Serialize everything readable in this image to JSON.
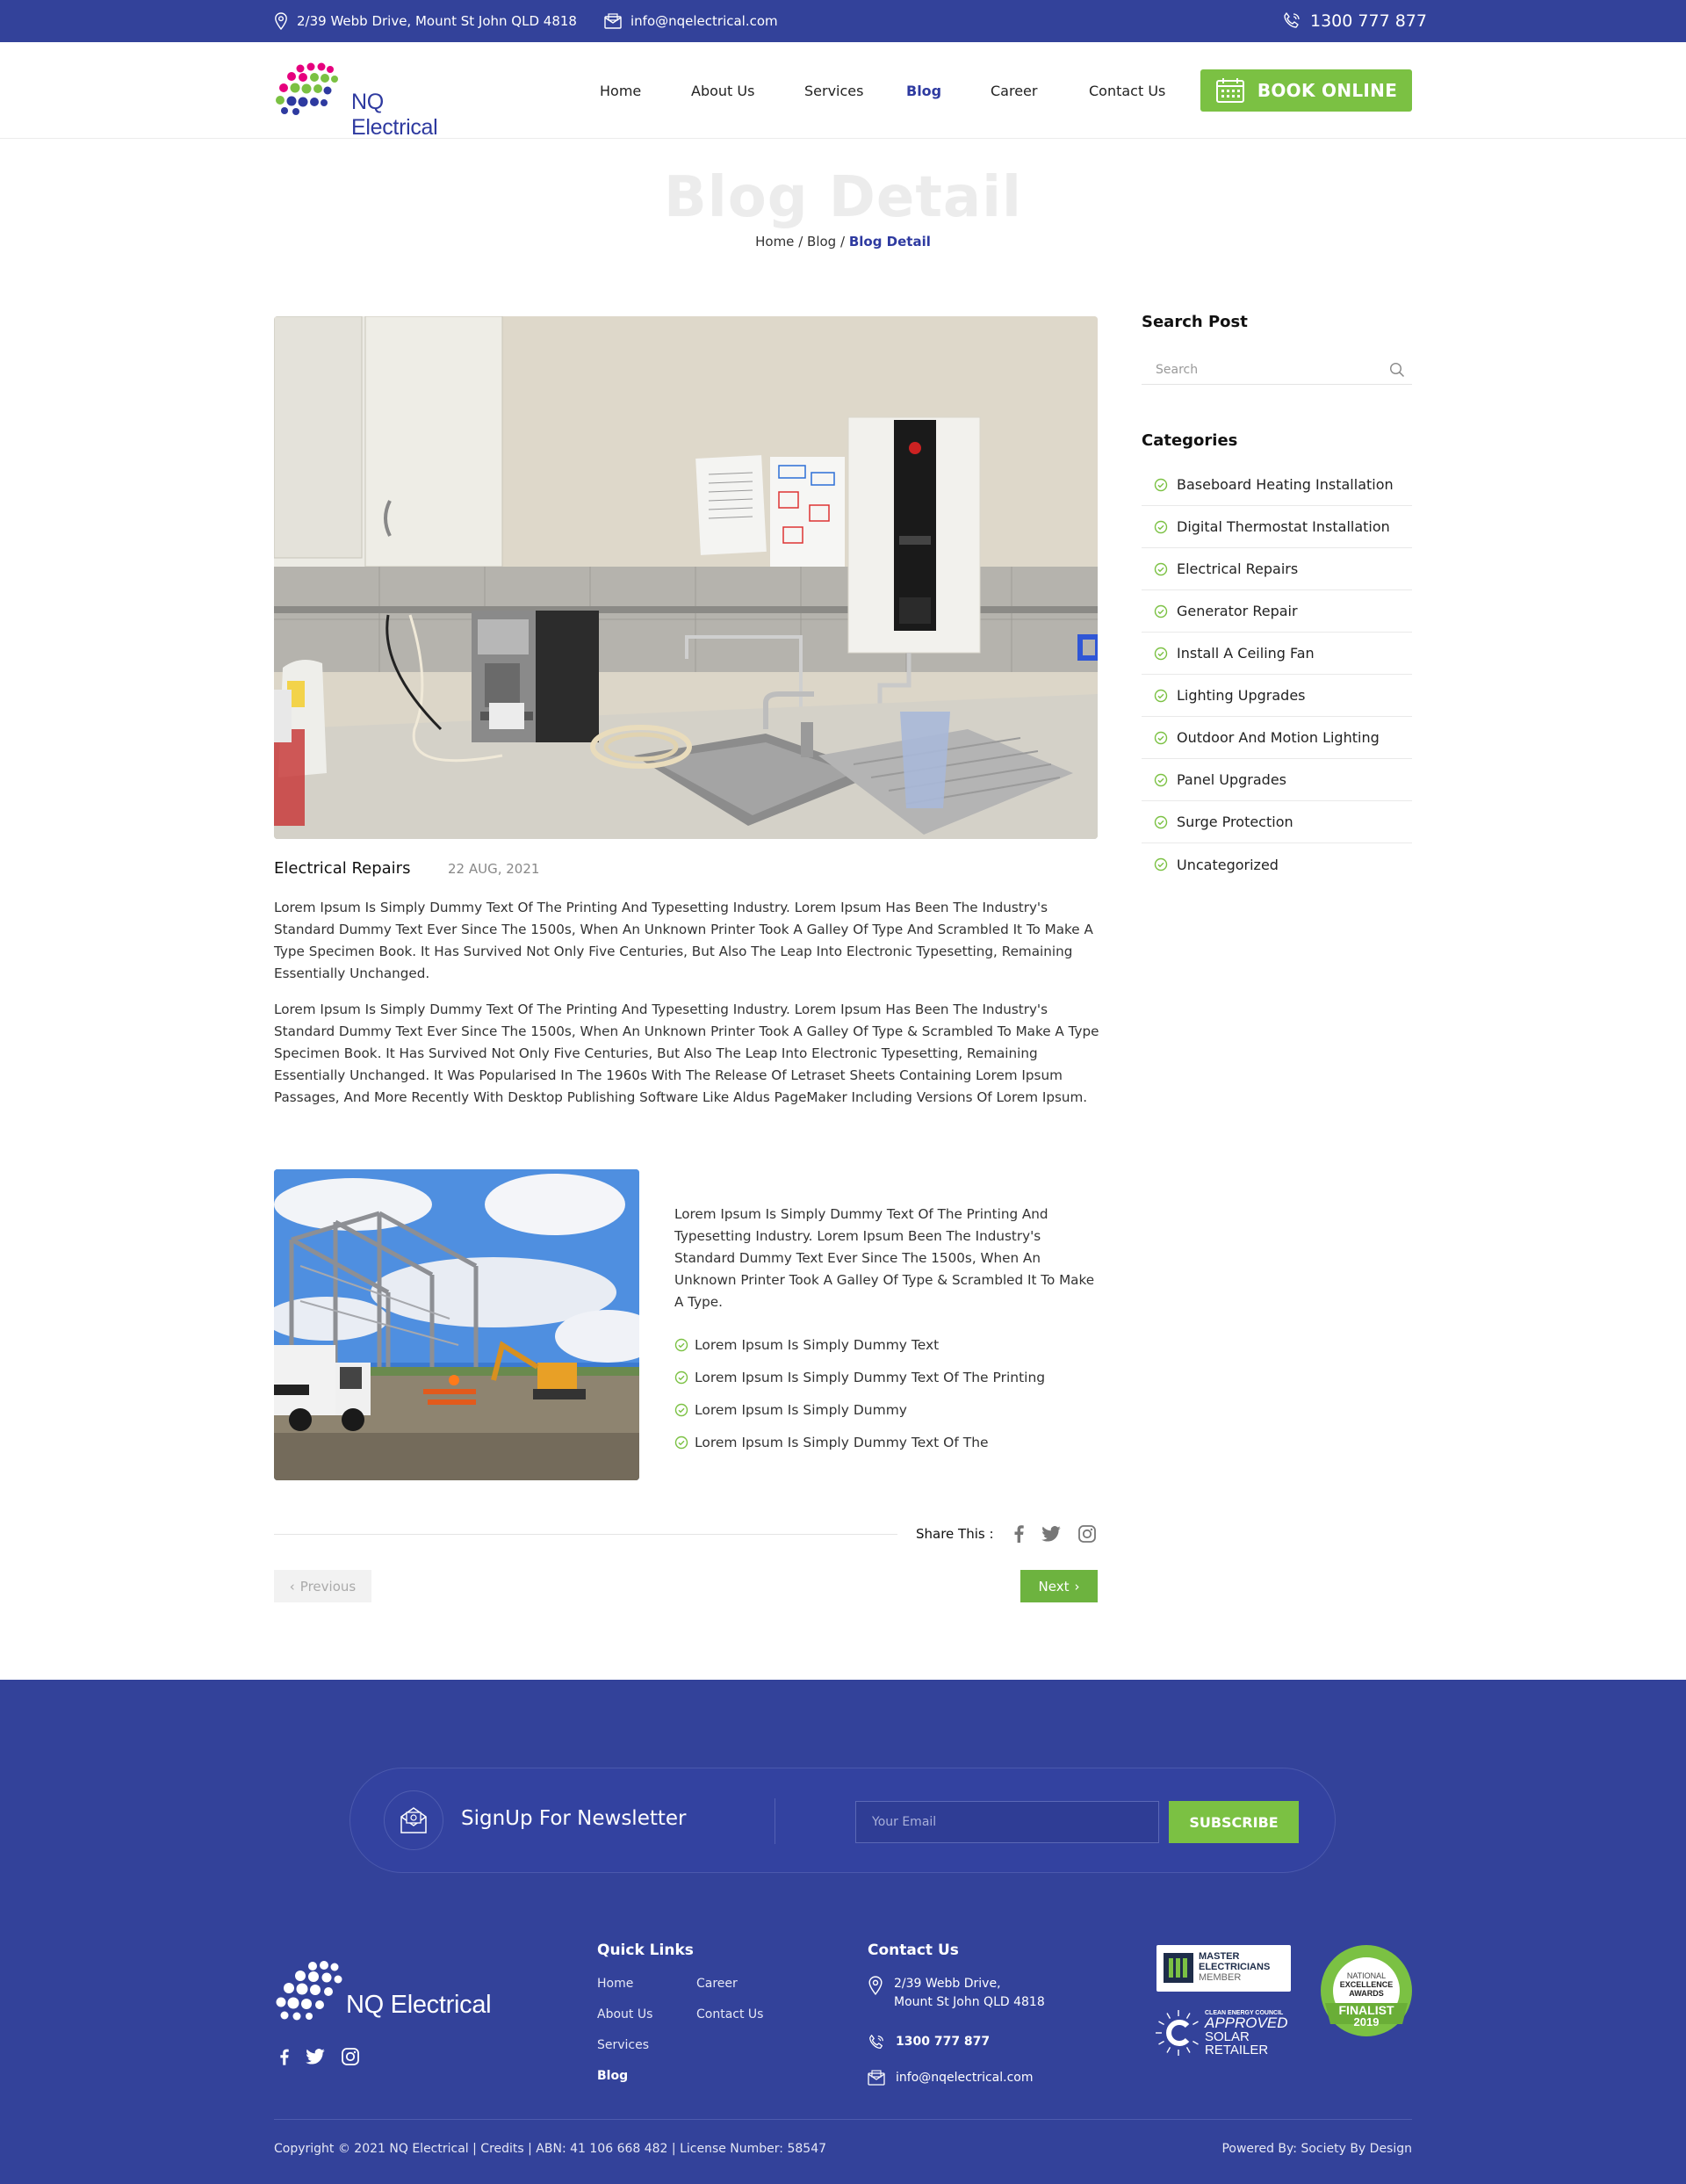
{
  "topbar": {
    "address": "2/39 Webb Drive,  Mount St John QLD 4818",
    "email": "info@nqelectrical.com",
    "phone": "1300 777 877"
  },
  "brand": {
    "name": "NQ Electrical"
  },
  "nav": {
    "items": [
      "Home",
      "About Us",
      "Services",
      "Blog",
      "Career",
      "Contact Us"
    ],
    "active": "Blog",
    "book_label": "BOOK ONLINE"
  },
  "page": {
    "title": "Blog Detail",
    "breadcrumb": {
      "home": "Home",
      "blog": "Blog",
      "current": "Blog Detail",
      "sep": "/"
    }
  },
  "post": {
    "category": "Electrical Repairs",
    "date": "22 AUG, 2021",
    "paragraphs": [
      "Lorem Ipsum Is Simply Dummy Text Of The Printing And Typesetting Industry. Lorem Ipsum Has Been The Industry's Standard Dummy Text Ever Since The 1500s, When An Unknown Printer Took A Galley Of Type And Scrambled It To Make A Type Specimen Book. It Has Survived Not Only Five Centuries, But Also The Leap Into Electronic Typesetting, Remaining Essentially Unchanged.",
      "Lorem Ipsum Is Simply Dummy Text Of The Printing And Typesetting Industry. Lorem Ipsum Has Been The Industry's Standard Dummy Text Ever Since The 1500s, When An Unknown Printer Took A Galley Of Type & Scrambled To Make A Type Specimen Book. It Has Survived Not Only Five Centuries, But Also The Leap Into Electronic Typesetting, Remaining Essentially Unchanged. It Was Popularised In The 1960s With The Release Of Letraset Sheets Containing Lorem Ipsum Passages, And More Recently With Desktop Publishing Software Like Aldus PageMaker Including Versions Of Lorem Ipsum."
    ],
    "side_text": "Lorem Ipsum Is Simply Dummy Text Of The Printing And Typesetting Industry. Lorem Ipsum Been The Industry's Standard Dummy Text Ever Since The 1500s, When An Unknown Printer Took A Galley Of Type & Scrambled It To Make A Type.",
    "checklist": [
      "Lorem Ipsum Is Simply Dummy Text",
      "Lorem Ipsum Is Simply Dummy Text Of The Printing",
      "Lorem Ipsum Is Simply Dummy",
      "Lorem Ipsum Is Simply Dummy Text Of The"
    ],
    "share_label": "Share This :",
    "prev_label": "Previous",
    "next_label": "Next"
  },
  "sidebar": {
    "search_heading": "Search Post",
    "search_placeholder": "Search",
    "categories_heading": "Categories",
    "categories": [
      "Baseboard Heating Installation",
      "Digital Thermostat Installation",
      "Electrical Repairs",
      "Generator Repair",
      "Install A Ceiling Fan",
      "Lighting Upgrades",
      "Outdoor And Motion Lighting",
      "Panel Upgrades",
      "Surge Protection",
      "Uncategorized"
    ]
  },
  "footer": {
    "newsletter_title": "SignUp For Newsletter",
    "email_placeholder": "Your Email",
    "subscribe_label": "SUBSCRIBE",
    "quick_links_heading": "Quick Links",
    "quick_links": [
      "Home",
      "About Us",
      "Services",
      "Blog",
      "Career",
      "Contact Us"
    ],
    "contact_heading": "Contact Us",
    "address_line1": "2/39 Webb Drive,",
    "address_line2": "Mount St John QLD 4818",
    "phone": "1300 777 877",
    "email": "info@nqelectrical.com",
    "badge_master": [
      "MASTER",
      "ELECTRICIANS",
      "MEMBER"
    ],
    "badge_solar": [
      "CLEAN ENERGY COUNCIL",
      "APPROVED",
      "SOLAR",
      "RETAILER"
    ],
    "badge_finalist": [
      "NATIONAL",
      "EXCELLENCE",
      "AWARDS",
      "FINALIST",
      "2019"
    ],
    "copyright": "Copyright © 2021 NQ Electrical | Credits  |  ABN: 41 106 668 482  |  License Number: 58547",
    "powered": "Powered By: Society By Design"
  },
  "colors": {
    "primary": "#33429a",
    "accent_green": "#7bc143",
    "active_link": "#2e3aa0"
  }
}
